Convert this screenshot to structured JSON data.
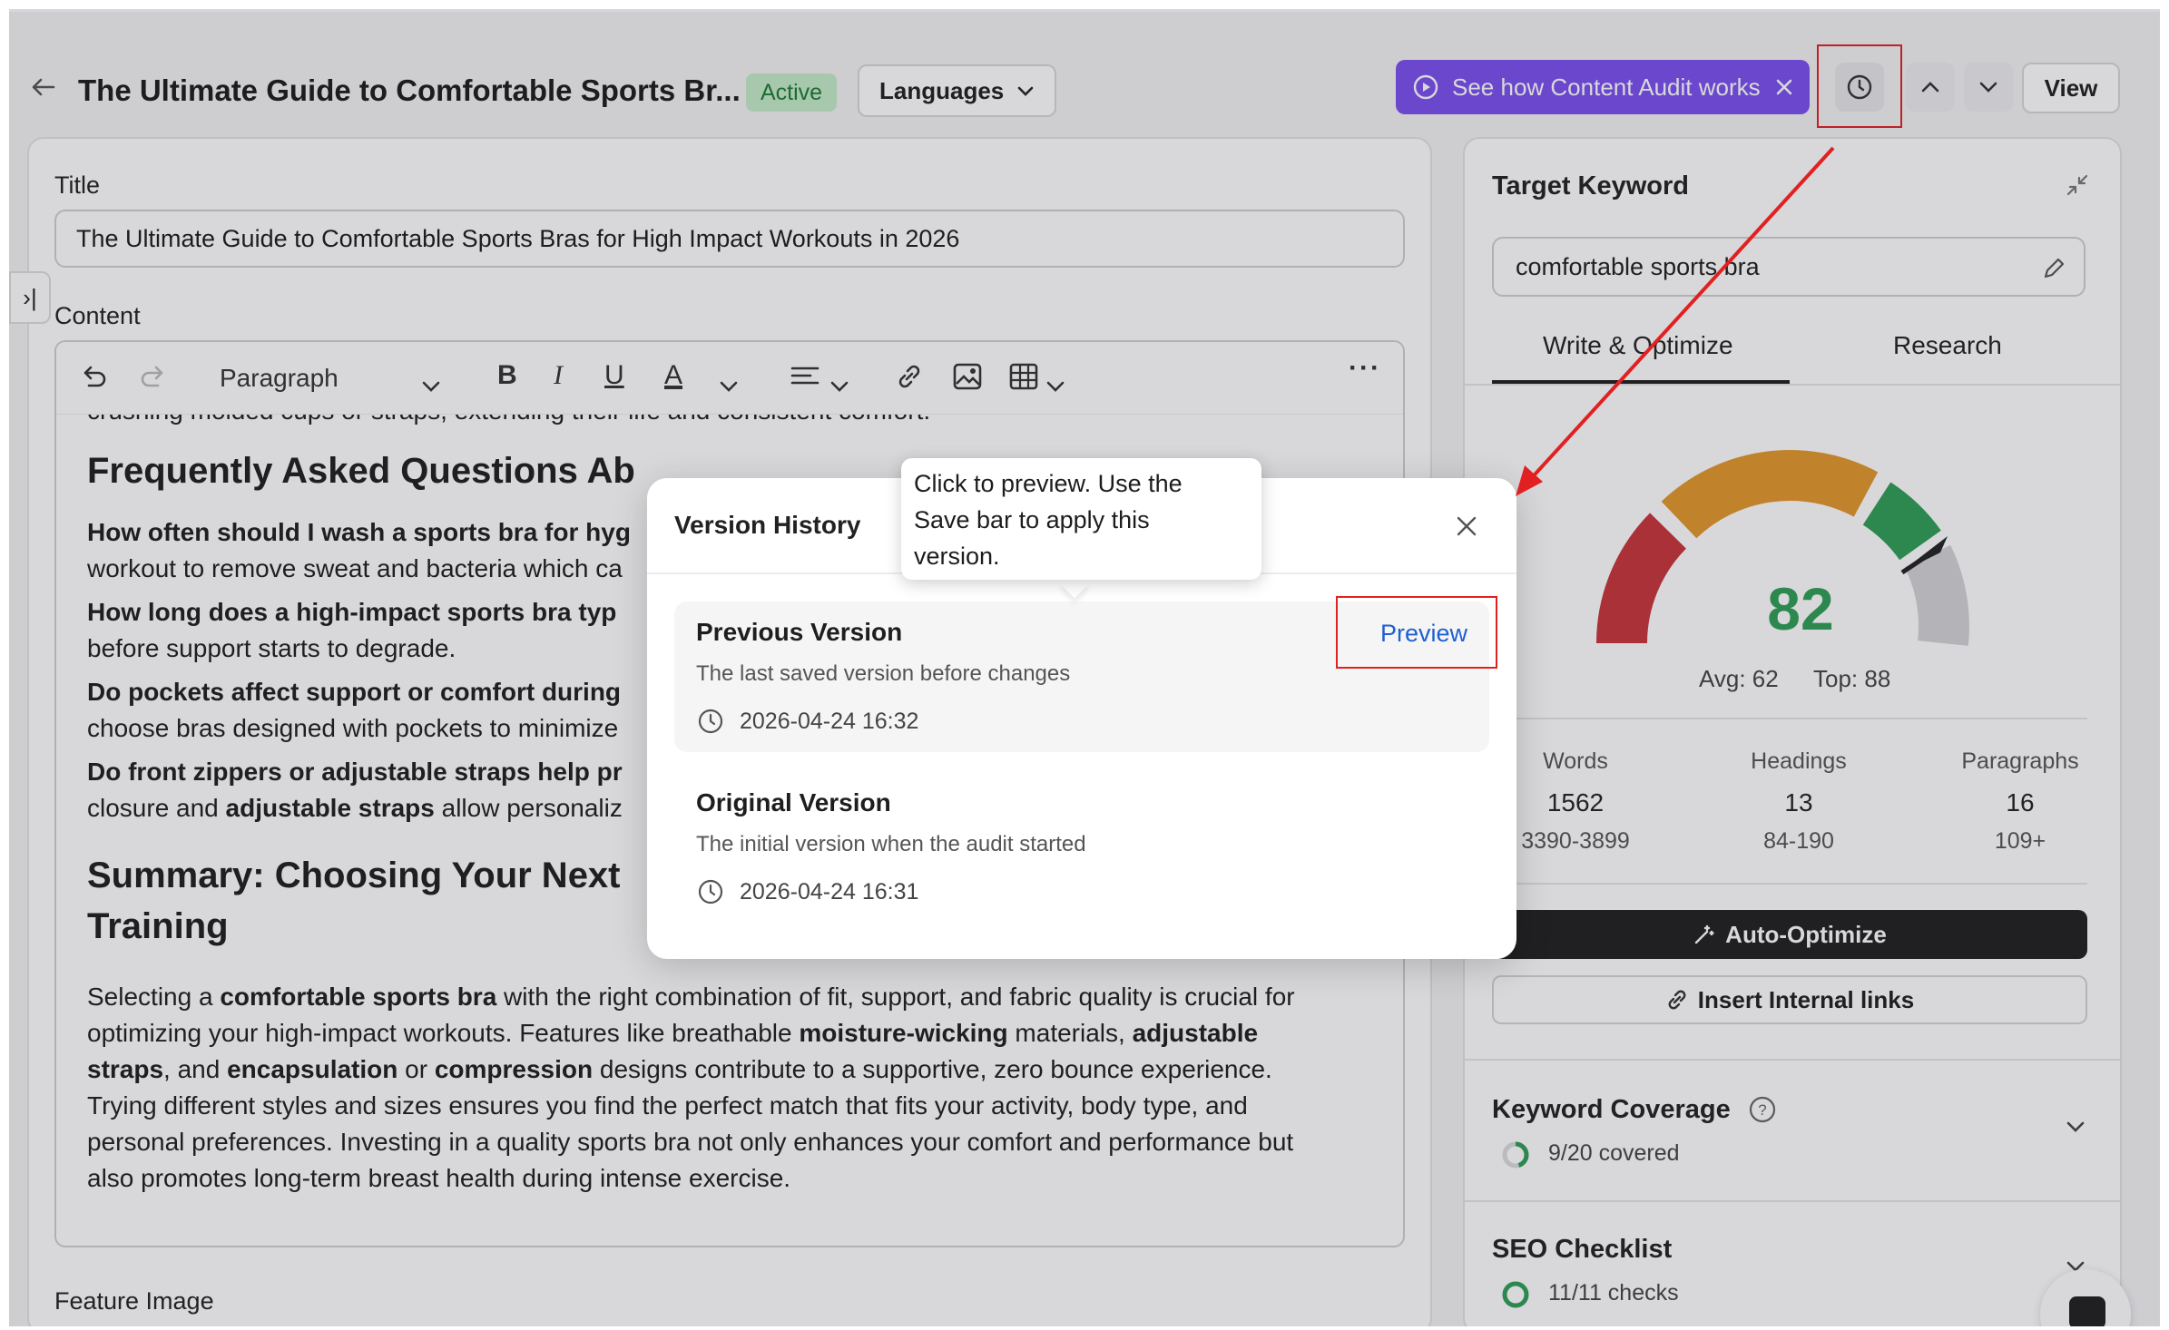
{
  "header": {
    "back_icon": "arrow-left-icon",
    "title": "The Ultimate Guide to Comfortable Sports Br...",
    "status_badge": "Active",
    "languages_label": "Languages",
    "audit_button_label": "See how Content Audit works",
    "view_label": "View"
  },
  "editor": {
    "title_label": "Title",
    "title_value": "The Ultimate Guide to Comfortable Sports Bras for High Impact Workouts in 2026",
    "content_label": "Content",
    "paragraph_style": "Paragraph",
    "feature_image_label": "Feature Image",
    "body": {
      "line_top": "crushing molded cups or straps, extending their life and consistent comfort.",
      "faq_heading": "Frequently Asked Questions Ab",
      "faq1_q": "How often should I wash a sports bra for hyg",
      "faq1_a": "workout to remove sweat and bacteria which ca",
      "faq2_q": "How long does a high-impact sports bra typ",
      "faq2_a": "before support starts to degrade.",
      "faq3_q": "Do pockets affect support or comfort during",
      "faq3_a": "choose bras designed with pockets to minimize",
      "faq4_q": "Do front zippers or adjustable straps help pr",
      "faq4_a_pre": "closure and ",
      "faq4_a_bold": "adjustable straps",
      "faq4_a_post": " allow personaliz",
      "summary_heading_1": "Summary: Choosing Your Next",
      "summary_heading_2": "Training",
      "summary_p1_a": "Selecting a ",
      "summary_p1_b": "comfortable sports bra",
      "summary_p1_c": " with the right combination of fit, support, and fabric quality is crucial for",
      "summary_p2_a": "optimizing your high-impact workouts. Features like breathable ",
      "summary_p2_b": "moisture-wicking",
      "summary_p2_c": " materials, ",
      "summary_p2_d": "adjustable",
      "summary_p3_a": "straps",
      "summary_p3_b": ", and ",
      "summary_p3_c": "encapsulation",
      "summary_p3_d": " or ",
      "summary_p3_e": "compression",
      "summary_p3_f": " designs contribute to a supportive, zero bounce experience.",
      "summary_p4": "Trying different styles and sizes ensures you find the perfect match that fits your activity, body type, and",
      "summary_p5": "personal preferences. Investing in a quality sports bra not only enhances your comfort and performance but",
      "summary_p6": "also promotes long-term breast health during intense exercise."
    }
  },
  "sidebar": {
    "target_keyword_label": "Target Keyword",
    "keyword_value": "comfortable sports bra",
    "tabs": [
      "Write & Optimize",
      "Research"
    ],
    "score": "82",
    "avg": "Avg: 62",
    "top": "Top: 88",
    "stats": [
      {
        "label": "Words",
        "value": "1562",
        "range": "3390-3899"
      },
      {
        "label": "Headings",
        "value": "13",
        "range": "84-190"
      },
      {
        "label": "Paragraphs",
        "value": "16",
        "range": "109+"
      }
    ],
    "auto_optimize_label": "Auto-Optimize",
    "insert_links_label": "Insert Internal links",
    "keyword_coverage_label": "Keyword Coverage",
    "keyword_coverage_value": "9/20 covered",
    "keyword_coverage_fraction": 0.45,
    "seo_checklist_label": "SEO Checklist",
    "seo_checklist_value": "11/11 checks"
  },
  "version_history": {
    "title": "Version History",
    "tooltip": "Click to preview. Use the Save bar to apply this version.",
    "tooltip_lines": [
      "Click to preview. Use the",
      "Save bar to apply this",
      "version."
    ],
    "preview_label": "Preview",
    "versions": [
      {
        "name": "Previous Version",
        "description": "The last saved version before changes",
        "time": "2026-04-24 16:32"
      },
      {
        "name": "Original Version",
        "description": "The initial version when the audit started",
        "time": "2026-04-24 16:31"
      }
    ]
  },
  "colors": {
    "accent_purple": "#7b4ff0",
    "score_green": "#2e9e55",
    "gauge_red": "#c8343a",
    "gauge_orange": "#e3962b",
    "gauge_green": "#2e9e55",
    "annotation_red": "#e12121",
    "preview_blue": "#1f5fd1"
  }
}
